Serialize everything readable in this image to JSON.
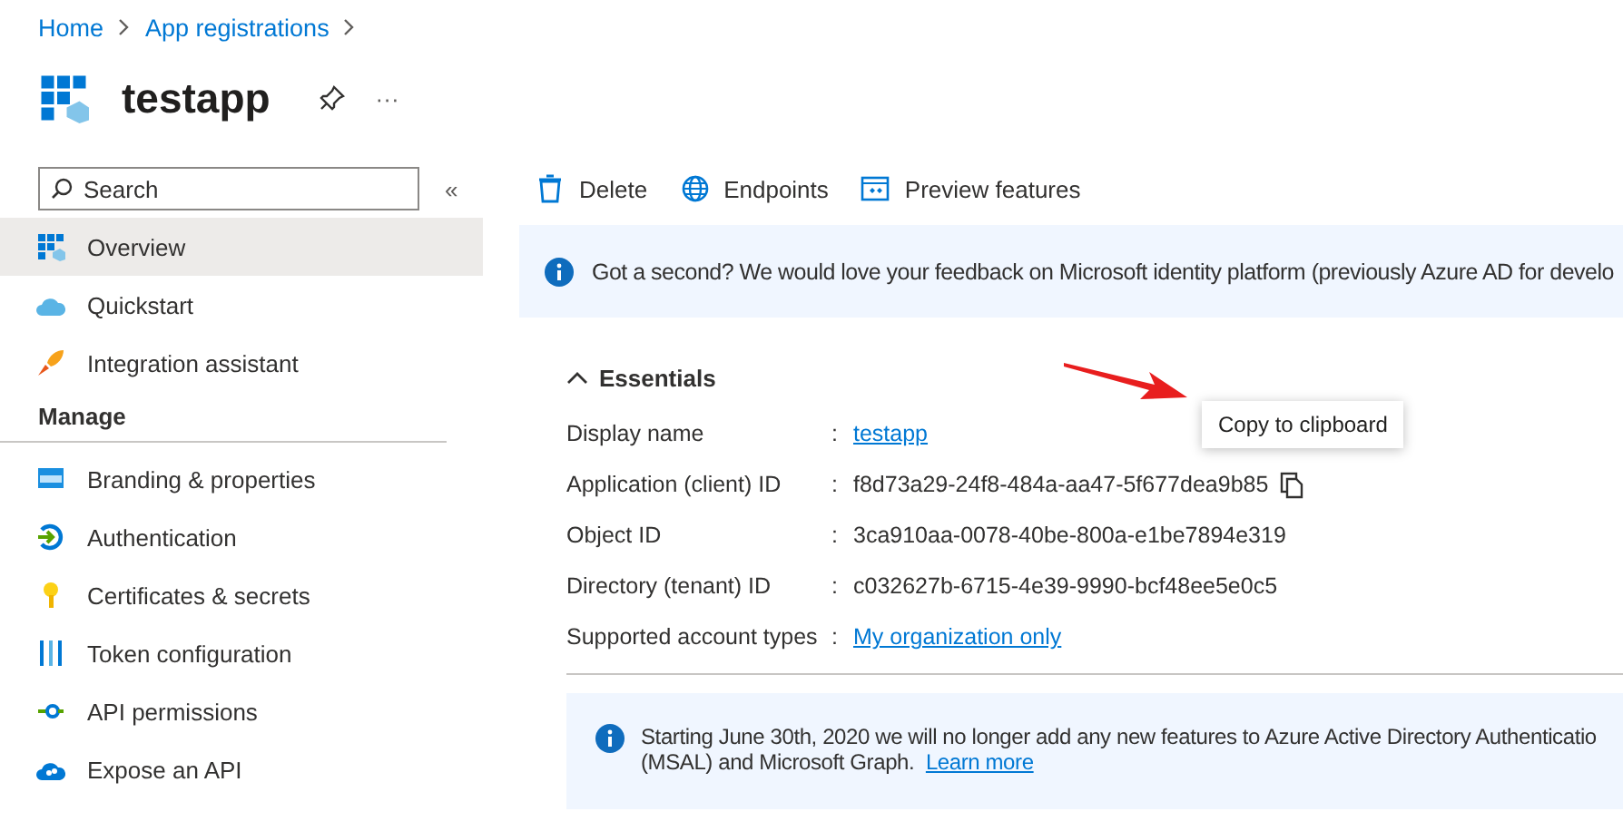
{
  "breadcrumb": [
    "Home",
    "App registrations"
  ],
  "title": "testapp",
  "more": "···",
  "search": {
    "placeholder": "Search"
  },
  "collapse": "«",
  "sidebar": {
    "items": [
      {
        "label": "Overview",
        "selected": true
      },
      {
        "label": "Quickstart",
        "selected": false
      },
      {
        "label": "Integration assistant",
        "selected": false
      }
    ],
    "section": "Manage",
    "manage_items": [
      {
        "label": "Branding & properties",
        "selected": false
      },
      {
        "label": "Authentication",
        "selected": false
      },
      {
        "label": "Certificates & secrets",
        "selected": false
      },
      {
        "label": "Token configuration",
        "selected": false
      },
      {
        "label": "API permissions",
        "selected": false
      },
      {
        "label": "Expose an API",
        "selected": false
      }
    ]
  },
  "toolbar": [
    "Delete",
    "Endpoints",
    "Preview features"
  ],
  "feedback_banner": "Got a second? We would love your feedback on Microsoft identity platform (previously Azure AD for develo",
  "essentials": {
    "title": "Essentials",
    "expanded": true,
    "rows": [
      {
        "label": "Display name",
        "separator": ":",
        "value": "testapp",
        "kind": "link"
      },
      {
        "label": "Application (client) ID",
        "separator": ":",
        "value": "f8d73a29-24f8-484a-aa47-5f677dea9b85",
        "kind": "copy"
      },
      {
        "label": "Object ID",
        "separator": ":",
        "value": "3ca910aa-0078-40be-800a-e1be7894e319",
        "kind": "text"
      },
      {
        "label": "Directory (tenant) ID",
        "separator": ":",
        "value": "c032627b-6715-4e39-9990-bcf48ee5e0c5",
        "kind": "text"
      },
      {
        "label": "Supported account types",
        "separator": ":",
        "value": "My organization only",
        "kind": "link"
      }
    ]
  },
  "tooltip": "Copy to clipboard",
  "info_banner": {
    "line_1": "Starting June 30th, 2020 we will no longer add any new features to Azure Active Directory Authenticatio",
    "line_2": "(MSAL) and Microsoft Graph.",
    "link": "Learn more"
  }
}
